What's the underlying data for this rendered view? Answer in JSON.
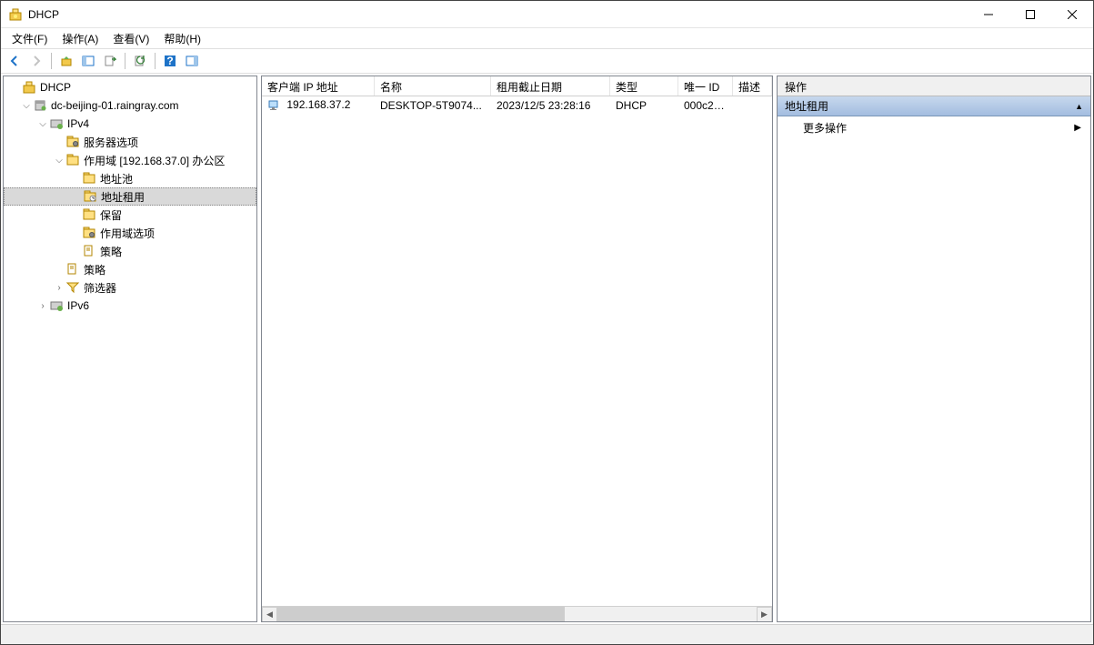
{
  "title": "DHCP",
  "menu": {
    "file": "文件(F)",
    "action": "操作(A)",
    "view": "查看(V)",
    "help": "帮助(H)"
  },
  "tree": {
    "root": "DHCP",
    "server": "dc-beijing-01.raingray.com",
    "ipv4": "IPv4",
    "server_options": "服务器选项",
    "scope": "作用域 [192.168.37.0] 办公区",
    "address_pool": "地址池",
    "address_leases": "地址租用",
    "reservations": "保留",
    "scope_options": "作用域选项",
    "policies_scope": "策略",
    "policies": "策略",
    "filters": "筛选器",
    "ipv6": "IPv6"
  },
  "columns": {
    "ip": "客户端 IP 地址",
    "name": "名称",
    "expiry": "租用截止日期",
    "type": "类型",
    "uid": "唯一 ID",
    "desc": "描述"
  },
  "rows": [
    {
      "ip": "192.168.37.2",
      "name": "DESKTOP-5T9074...",
      "expiry": "2023/12/5 23:28:16",
      "type": "DHCP",
      "uid": "000c29...",
      "desc": ""
    }
  ],
  "actions": {
    "header": "操作",
    "group": "地址租用",
    "more": "更多操作"
  }
}
